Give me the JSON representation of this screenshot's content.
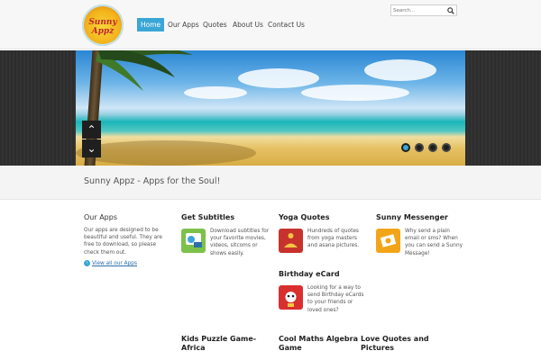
{
  "header": {
    "logo_text": "Sunny Appz",
    "nav": [
      {
        "label": "Home",
        "active": true
      },
      {
        "label": "Our Apps",
        "active": false
      },
      {
        "label": "Quotes",
        "active": false
      },
      {
        "label": "About Us",
        "active": false
      },
      {
        "label": "Contact Us",
        "active": false
      }
    ],
    "search_placeholder": "Search..."
  },
  "slider": {
    "up_glyph": "⌃",
    "down_glyph": "⌄",
    "dot_count": 4,
    "active_dot": 0
  },
  "tagline": "Sunny Appz - Apps for the Soul!",
  "our_apps": {
    "title": "Our Apps",
    "text": "Our apps are designed to be beautiful and useful. They are free to download, so please check them out.",
    "link": "View all our Apps"
  },
  "apps": [
    {
      "title": "Get Subtitles",
      "text": "Download subtitles for your favorite movies, videos, sitcoms or shows easily.",
      "icon": "subtitles-icon"
    },
    {
      "title": "Yoga Quotes",
      "text": "Hundreds of quotes from yoga masters and asana pictures.",
      "icon": "yoga-icon"
    },
    {
      "title": "Sunny Messenger",
      "text": "Why send a plain email or sms? When you can send a Sunny Message!",
      "icon": "messenger-icon"
    },
    {
      "title": "Birthday eCard",
      "text": "Looking for a way to send Birthday eCards to your friends or loved ones?",
      "icon": "birthday-icon"
    }
  ],
  "bottom_titles": [
    "Kids Puzzle Game- Africa",
    "Cool Maths Algebra Game",
    "Love Quotes and Pictures"
  ],
  "colors": {
    "accent": "#3aa6d6",
    "header_bg": "#f7f7f7",
    "slider_band": "#2d2d2d"
  }
}
